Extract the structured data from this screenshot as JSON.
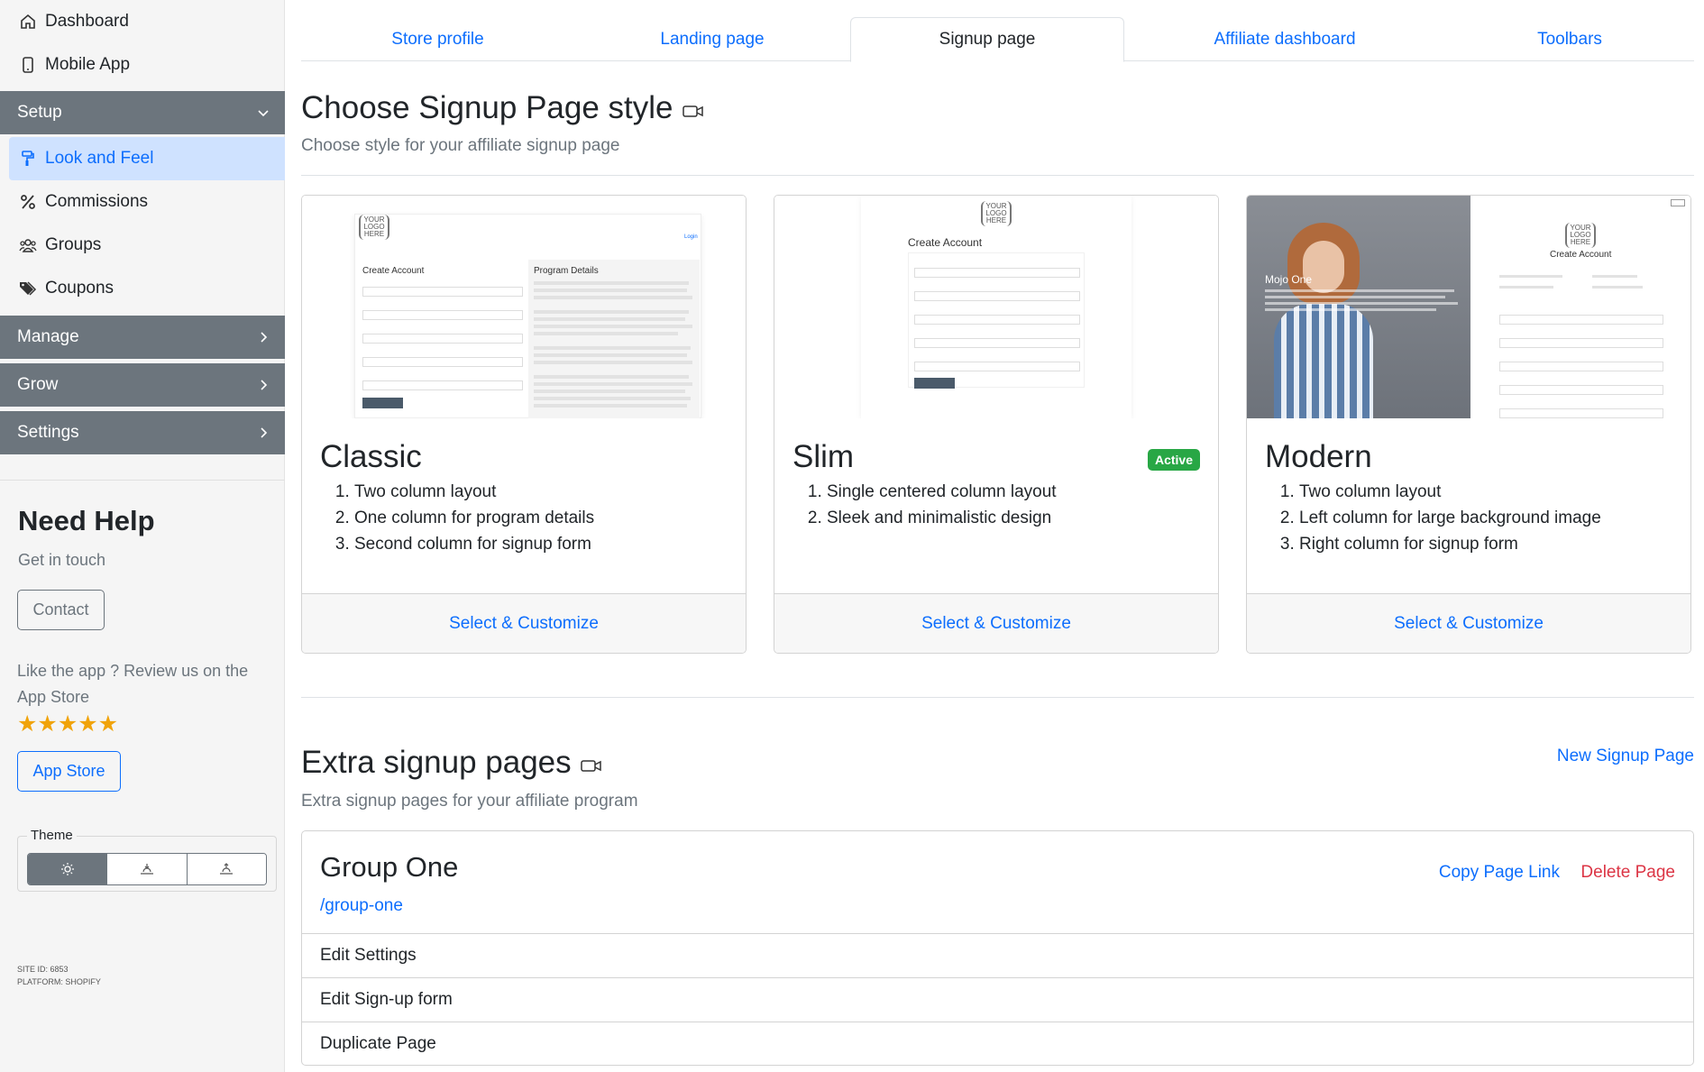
{
  "sidebar": {
    "top_items": [
      {
        "label": "Dashboard",
        "icon": "home-icon"
      },
      {
        "label": "Mobile App",
        "icon": "mobile-icon"
      }
    ],
    "setup_label": "Setup",
    "setup_items": [
      {
        "label": "Look and Feel",
        "icon": "paint-roller-icon",
        "active": true
      },
      {
        "label": "Commissions",
        "icon": "percent-icon"
      },
      {
        "label": "Groups",
        "icon": "users-icon"
      },
      {
        "label": "Coupons",
        "icon": "tags-icon"
      }
    ],
    "manage_label": "Manage",
    "grow_label": "Grow",
    "settings_label": "Settings"
  },
  "help": {
    "title": "Need Help",
    "subtitle": "Get in touch",
    "contact_label": "Contact",
    "review_text": "Like the app ? Review us on the App Store",
    "stars": "★★★★★",
    "rating_count": 5,
    "app_store_label": "App Store",
    "theme_legend": "Theme"
  },
  "site_info": {
    "site_id": "SITE ID: 6853",
    "platform": "PLATFORM: SHOPIFY"
  },
  "tabs": [
    {
      "label": "Store profile",
      "active": false
    },
    {
      "label": "Landing page",
      "active": false
    },
    {
      "label": "Signup page",
      "active": true
    },
    {
      "label": "Affiliate dashboard",
      "active": false
    },
    {
      "label": "Toolbars",
      "active": false
    }
  ],
  "style_section": {
    "title": "Choose Signup Page style",
    "subtitle": "Choose style for your affiliate signup page",
    "cards": [
      {
        "title": "Classic",
        "active": false,
        "features": [
          "Two column layout",
          "One column for program details",
          "Second column for signup form"
        ],
        "action": "Select & Customize"
      },
      {
        "title": "Slim",
        "active": true,
        "badge": "Active",
        "features": [
          "Single centered column layout",
          "Sleek and minimalistic design"
        ],
        "action": "Select & Customize"
      },
      {
        "title": "Modern",
        "active": false,
        "features": [
          "Two column layout",
          "Left column for large background image",
          "Right column for signup form"
        ],
        "action": "Select & Customize"
      }
    ]
  },
  "thumbs": {
    "logo": "YOUR LOGO HERE",
    "create_account": "Create Account",
    "program_details": "Program Details",
    "login": "Login",
    "brand": "Mojo One"
  },
  "extra_section": {
    "title": "Extra signup pages",
    "subtitle": "Extra signup pages for your affiliate program",
    "new_link": "New Signup Page",
    "page": {
      "title": "Group One",
      "path": "/group-one",
      "copy_label": "Copy Page Link",
      "delete_label": "Delete Page",
      "rows": [
        "Edit Settings",
        "Edit Sign-up form",
        "Duplicate Page"
      ]
    }
  },
  "colors": {
    "primary": "#0d6efd",
    "danger": "#dc3545",
    "success": "#28a745",
    "sidebar_section": "#6c757d",
    "star": "#f0a30a"
  }
}
